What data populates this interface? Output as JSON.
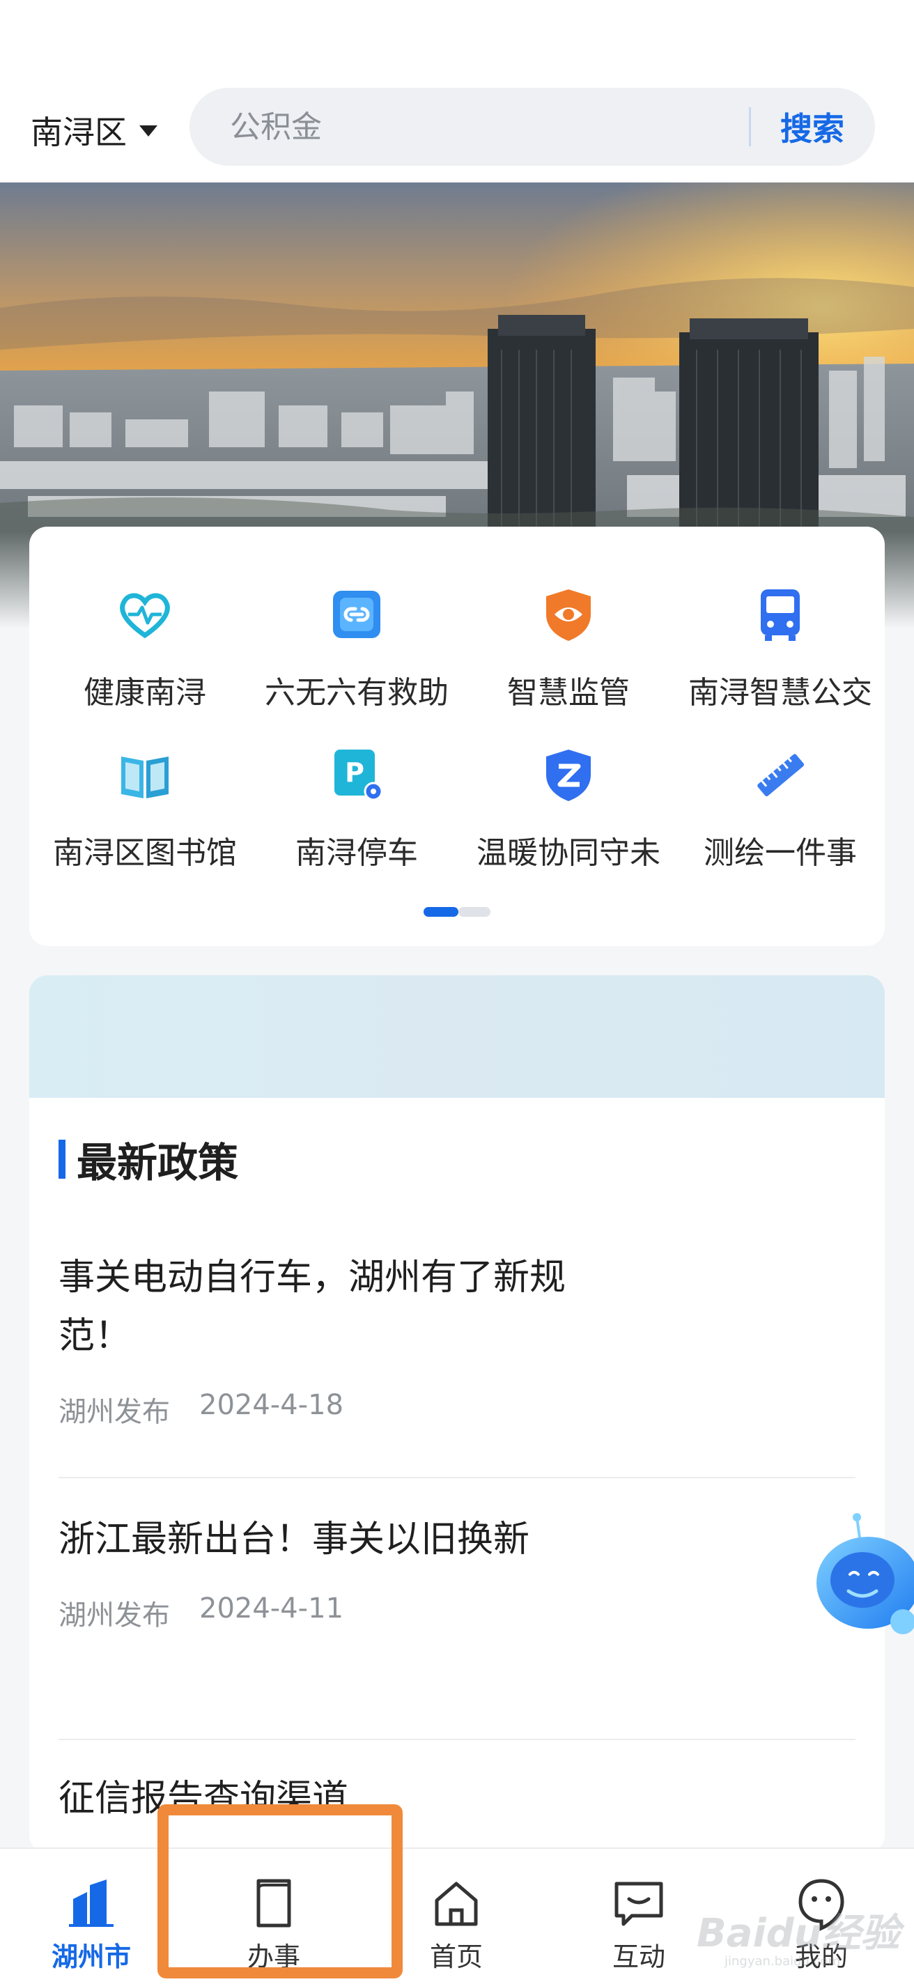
{
  "header": {
    "region": "南浔区",
    "search_placeholder": "公积金",
    "search_button": "搜索"
  },
  "quick_services": [
    {
      "label": "健康南浔",
      "icon": "heart-pulse-icon"
    },
    {
      "label": "六无六有救助",
      "icon": "link-icon"
    },
    {
      "label": "智慧监管",
      "icon": "eye-shield-icon"
    },
    {
      "label": "南浔智慧公交",
      "icon": "bus-icon"
    },
    {
      "label": "南浔区图书馆",
      "icon": "book-icon"
    },
    {
      "label": "南浔停车",
      "icon": "parking-icon"
    },
    {
      "label": "温暖协同守未",
      "icon": "z-shield-icon"
    },
    {
      "label": "测绘一件事",
      "icon": "ruler-icon"
    }
  ],
  "pager": {
    "current": 1,
    "total": 2
  },
  "policy": {
    "section_title": "最新政策",
    "items": [
      {
        "title": "事关电动自行车，湖州有了新规范！",
        "source": "湖州发布",
        "date": "2024-4-18"
      },
      {
        "title": "浙江最新出台！事关以旧换新",
        "source": "湖州发布",
        "date": "2024-4-11"
      },
      {
        "title": "征信报告查询渠道",
        "source": "",
        "date": ""
      }
    ]
  },
  "tabbar": [
    {
      "label": "湖州市",
      "icon": "city-buildings-icon",
      "active": true
    },
    {
      "label": "办事",
      "icon": "document-icon",
      "active": false
    },
    {
      "label": "首页",
      "icon": "home-icon",
      "active": false
    },
    {
      "label": "互动",
      "icon": "chat-icon",
      "active": false
    },
    {
      "label": "我的",
      "icon": "user-bubble-icon",
      "active": false
    }
  ],
  "watermark": {
    "text": "Baidu经验",
    "sub": "jingyan.baidu.com"
  },
  "colors": {
    "accent": "#1669e6",
    "highlight": "#f08a3a",
    "orange_icon": "#f07a2a"
  }
}
